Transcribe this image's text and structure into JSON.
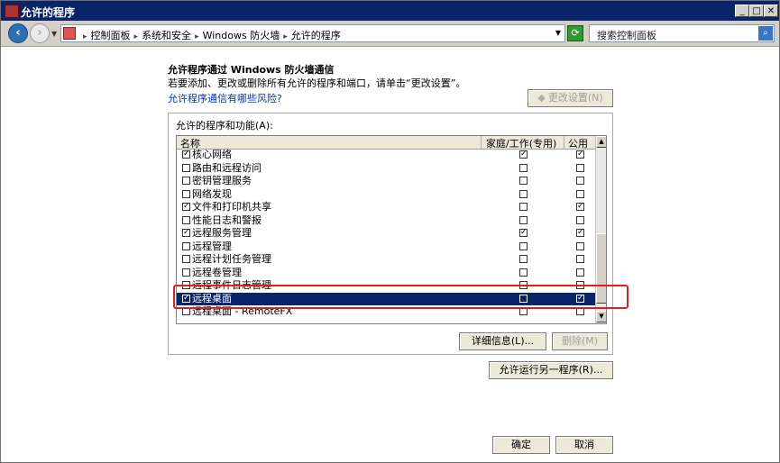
{
  "window": {
    "title": "允许的程序"
  },
  "address": {
    "crumbs": [
      "控制面板",
      "系统和安全",
      "Windows 防火墙",
      "允许的程序"
    ],
    "search_placeholder": "搜索控制面板"
  },
  "main": {
    "heading": "允许程序通过 Windows 防火墙通信",
    "description": "若要添加、更改或删除所有允许的程序和端口，请单击“更改设置”。",
    "risk_link": "允许程序通信有哪些风险?",
    "change_settings": "更改设置(N)"
  },
  "group": {
    "label": "允许的程序和功能(A):",
    "columns": {
      "name": "名称",
      "home": "家庭/工作(专用)",
      "public": "公用"
    },
    "rows": [
      {
        "name": "核心网络",
        "checked": true,
        "home": true,
        "public": true
      },
      {
        "name": "路由和远程访问",
        "checked": false,
        "home": false,
        "public": false
      },
      {
        "name": "密钥管理服务",
        "checked": false,
        "home": false,
        "public": false
      },
      {
        "name": "网络发现",
        "checked": false,
        "home": false,
        "public": false
      },
      {
        "name": "文件和打印机共享",
        "checked": true,
        "home": false,
        "public": true
      },
      {
        "name": "性能日志和警报",
        "checked": false,
        "home": false,
        "public": false
      },
      {
        "name": "远程服务管理",
        "checked": true,
        "home": true,
        "public": true
      },
      {
        "name": "远程管理",
        "checked": false,
        "home": false,
        "public": false
      },
      {
        "name": "远程计划任务管理",
        "checked": false,
        "home": false,
        "public": false
      },
      {
        "name": "远程卷管理",
        "checked": false,
        "home": false,
        "public": false
      },
      {
        "name": "远程事件日志管理",
        "checked": false,
        "home": false,
        "public": false
      },
      {
        "name": "远程桌面",
        "checked": true,
        "home": false,
        "public": true,
        "selected": true
      },
      {
        "name": "远程桌面 - RemoteFX",
        "checked": false,
        "home": false,
        "public": false
      }
    ],
    "details_button": "详细信息(L)...",
    "remove_button": "删除(M)"
  },
  "allow_another": "允许运行另一程序(R)...",
  "ok_button": "确定",
  "cancel_button": "取消",
  "colors": {
    "title_bar": "#0a246a",
    "selected_row": "#0a246a",
    "highlight": "#e02020",
    "link": "#0033cc"
  },
  "icons": [
    "firewall-app-icon",
    "back-icon",
    "forward-icon",
    "control-panel-icon",
    "refresh-icon",
    "search-icon",
    "shield-icon"
  ]
}
